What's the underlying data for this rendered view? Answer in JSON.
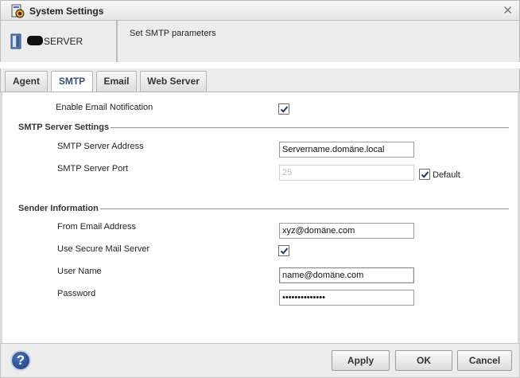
{
  "window": {
    "title": "System Settings",
    "close_glyph": "✕"
  },
  "header": {
    "server_name": "SERVER",
    "description": "Set SMTP parameters"
  },
  "tabs": [
    {
      "label": "Agent",
      "active": false
    },
    {
      "label": "SMTP",
      "active": true
    },
    {
      "label": "Email",
      "active": false
    },
    {
      "label": "Web Server",
      "active": false
    }
  ],
  "form": {
    "enable_email_notification": {
      "label": "Enable Email Notification",
      "checked": true
    },
    "smtp_section": {
      "title": "SMTP Server Settings"
    },
    "smtp_address": {
      "label": "SMTP Server Address",
      "value": "Servername.domäne.local"
    },
    "smtp_port": {
      "label": "SMTP Server Port",
      "value": "25",
      "disabled": true,
      "default_label": "Default",
      "default_checked": true
    },
    "sender_section": {
      "title": "Sender Information"
    },
    "from_email": {
      "label": "From Email Address",
      "value": "xyz@domäne.com"
    },
    "secure_mail": {
      "label": "Use Secure Mail Server",
      "checked": true
    },
    "user_name": {
      "label": "User Name",
      "value": "name@domäne.com"
    },
    "password": {
      "label": "Password",
      "value": "••••••••••••••"
    }
  },
  "footer": {
    "help_glyph": "?",
    "apply_label": "Apply",
    "ok_label": "OK",
    "cancel_label": "Cancel"
  },
  "colors": {
    "active_tab_text": "#33506e",
    "help_icon": "#2a4f94"
  },
  "icons": {
    "app": "settings-app-icon",
    "server": "server-icon",
    "check": "check-icon",
    "help": "help-icon",
    "close": "close-icon"
  }
}
